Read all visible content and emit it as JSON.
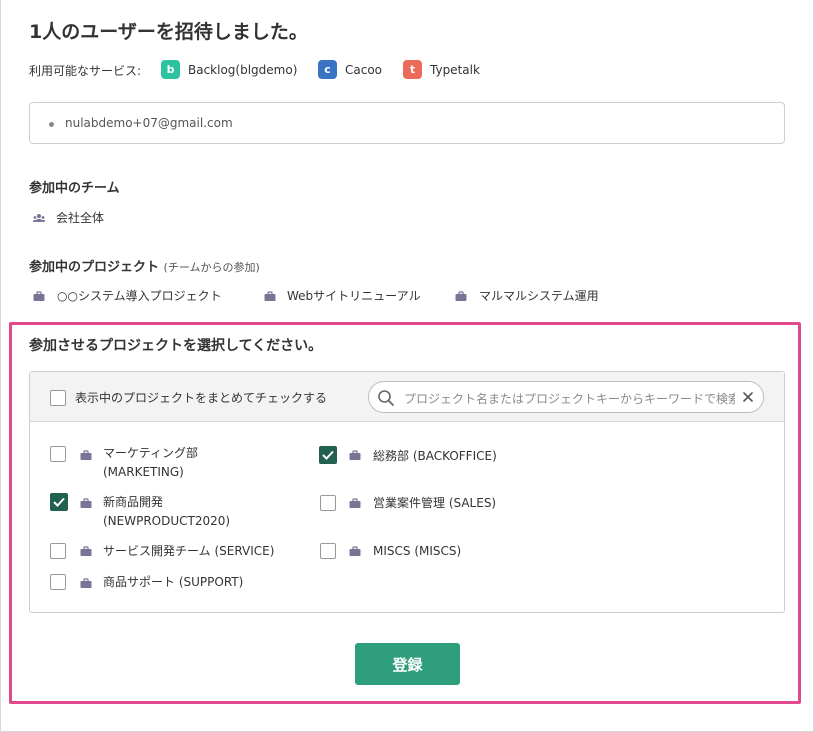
{
  "page": {
    "title": "1人のユーザーを招待しました。"
  },
  "services": {
    "label": "利用可能なサービス:",
    "items": [
      {
        "name": "Backlog(blgdemo)",
        "icon": "backlog-icon",
        "glyph": "b",
        "color": "#2dc3a0"
      },
      {
        "name": "Cacoo",
        "icon": "cacoo-icon",
        "glyph": "c",
        "color": "#3a72c4"
      },
      {
        "name": "Typetalk",
        "icon": "typetalk-icon",
        "glyph": "t",
        "color": "#ec6a5a"
      }
    ]
  },
  "email_list": {
    "emails": [
      "nulabdemo+07@gmail.com"
    ]
  },
  "teams": {
    "heading": "参加中のチーム",
    "items": [
      "会社全体"
    ]
  },
  "projects": {
    "heading": "参加中のプロジェクト",
    "subheading": "(チームからの参加)",
    "items": [
      "○○システム導入プロジェクト",
      "Webサイトリニューアル",
      "マルマルシステム運用"
    ]
  },
  "select_section": {
    "heading": "参加させるプロジェクトを選択してください。",
    "select_all_label": "表示中のプロジェクトをまとめてチェックする",
    "search_placeholder": "プロジェクト名またはプロジェクトキーからキーワードで検索",
    "accent_color": "#e0498b",
    "checked_color": "#22614f",
    "project_options": [
      {
        "line1": "マーケティング部",
        "line2": "(MARKETING)",
        "checked": false
      },
      {
        "line1": "総務部 (BACKOFFICE)",
        "line2": "",
        "checked": true
      },
      {
        "line1": "新商品開発",
        "line2": "(NEWPRODUCT2020)",
        "checked": true
      },
      {
        "line1": "営業案件管理 (SALES)",
        "line2": "",
        "checked": false
      },
      {
        "line1": "サービス開発チーム (SERVICE)",
        "line2": "",
        "checked": false
      },
      {
        "line1": "MISCS (MISCS)",
        "line2": "",
        "checked": false
      },
      {
        "line1": "商品サポート (SUPPORT)",
        "line2": "",
        "checked": false
      }
    ]
  },
  "submit": {
    "label": "登録",
    "color": "#2f9e7c"
  }
}
